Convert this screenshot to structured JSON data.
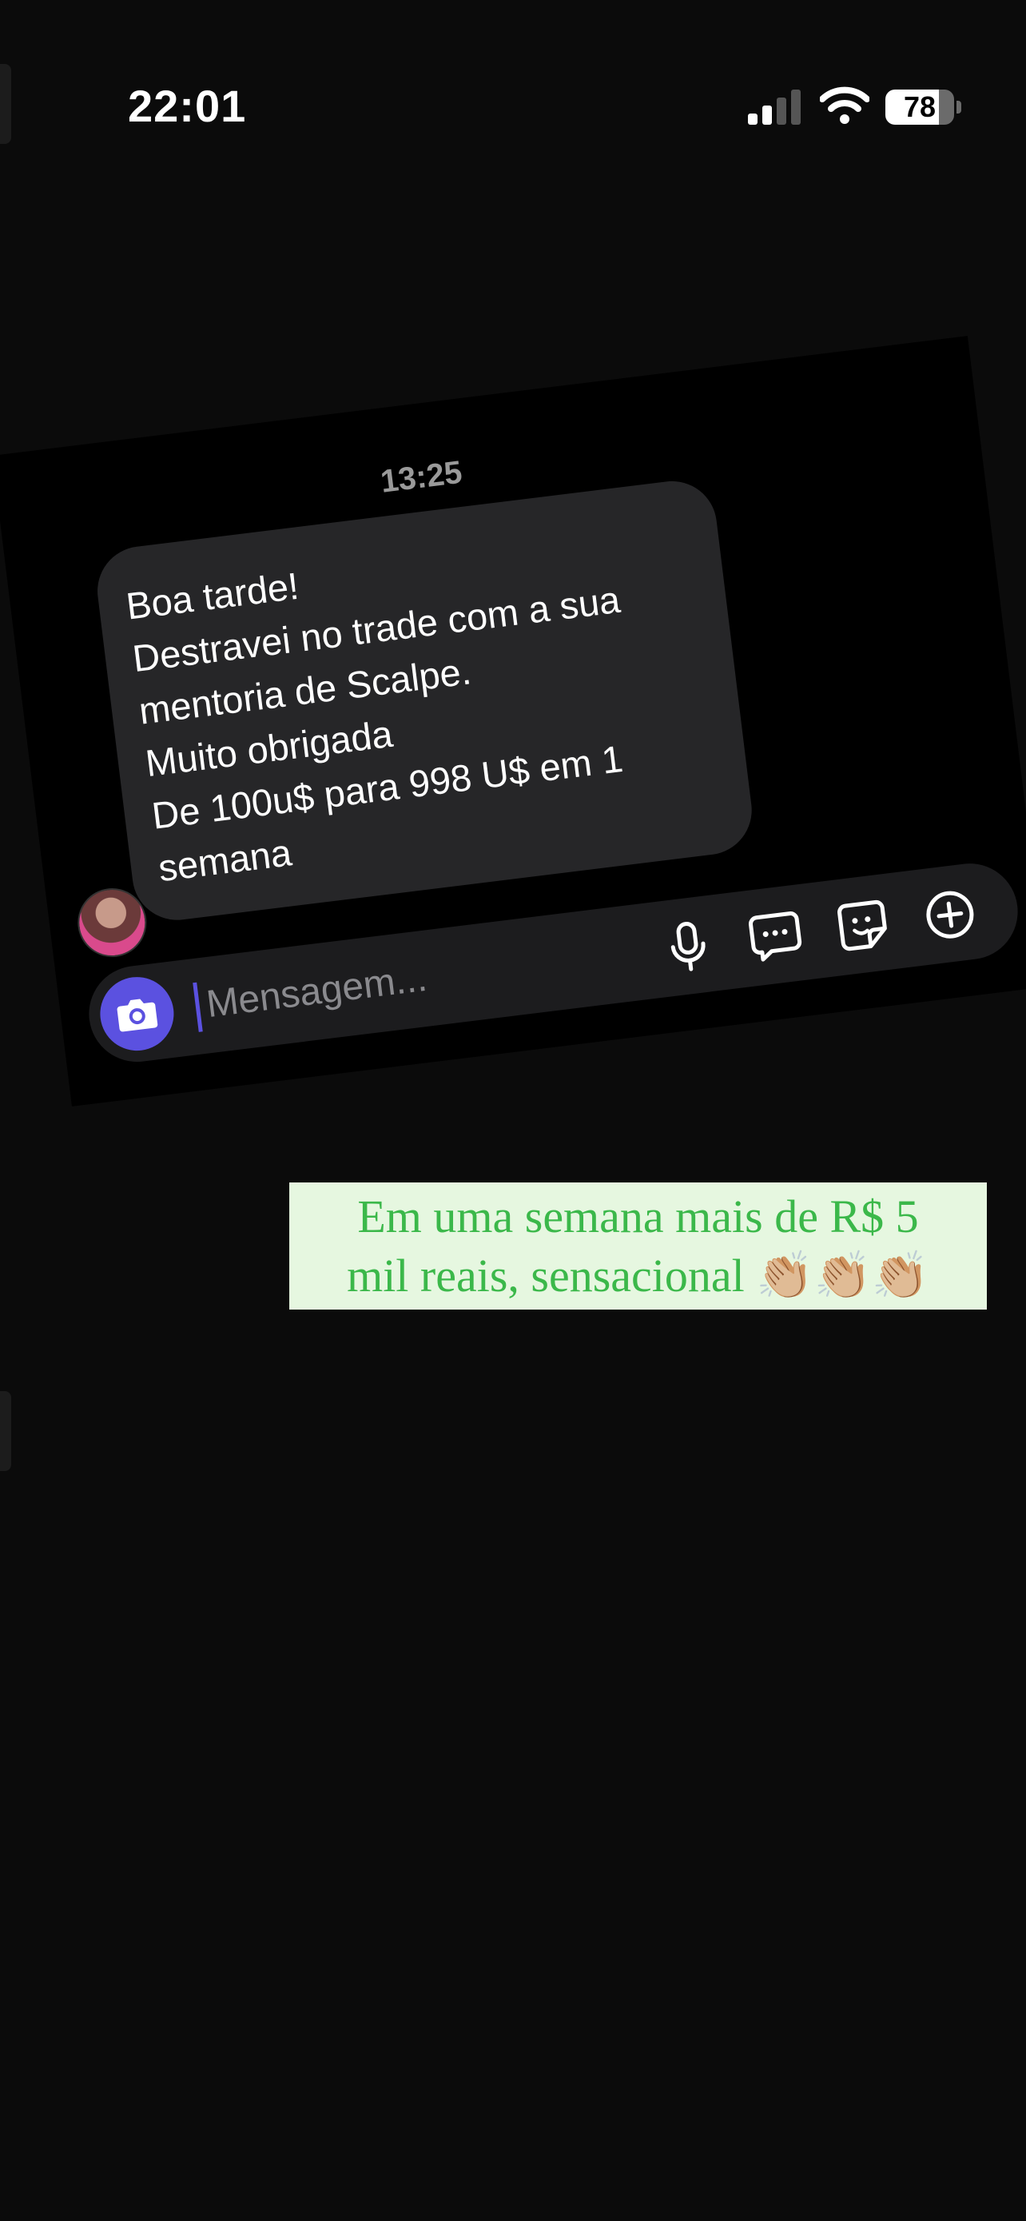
{
  "status_bar": {
    "time": "22:01",
    "battery": "78"
  },
  "conversation": {
    "timestamp": "13:25",
    "message_lines": [
      "Boa tarde!",
      "Destravei no trade com a sua",
      "mentoria de Scalpe.",
      "Muito obrigada",
      "De 100u$ para 998 U$ em 1",
      "semana"
    ],
    "composer": {
      "placeholder": "Mensagem..."
    }
  },
  "caption": {
    "line1": "Em uma semana mais de R$ 5",
    "line2": "mil reais, sensacional 👏🏼👏🏼👏🏼"
  },
  "icons": [
    "signal-icon",
    "wifi-icon",
    "battery-icon",
    "camera-icon",
    "microphone-icon",
    "chat-bubble-icon",
    "sticker-icon",
    "plus-circle-icon"
  ],
  "colors": {
    "accent": "#5b51e0",
    "bubble": "#262628",
    "caption_text": "#3bb84a",
    "caption_bg": "#e6f7e0"
  }
}
